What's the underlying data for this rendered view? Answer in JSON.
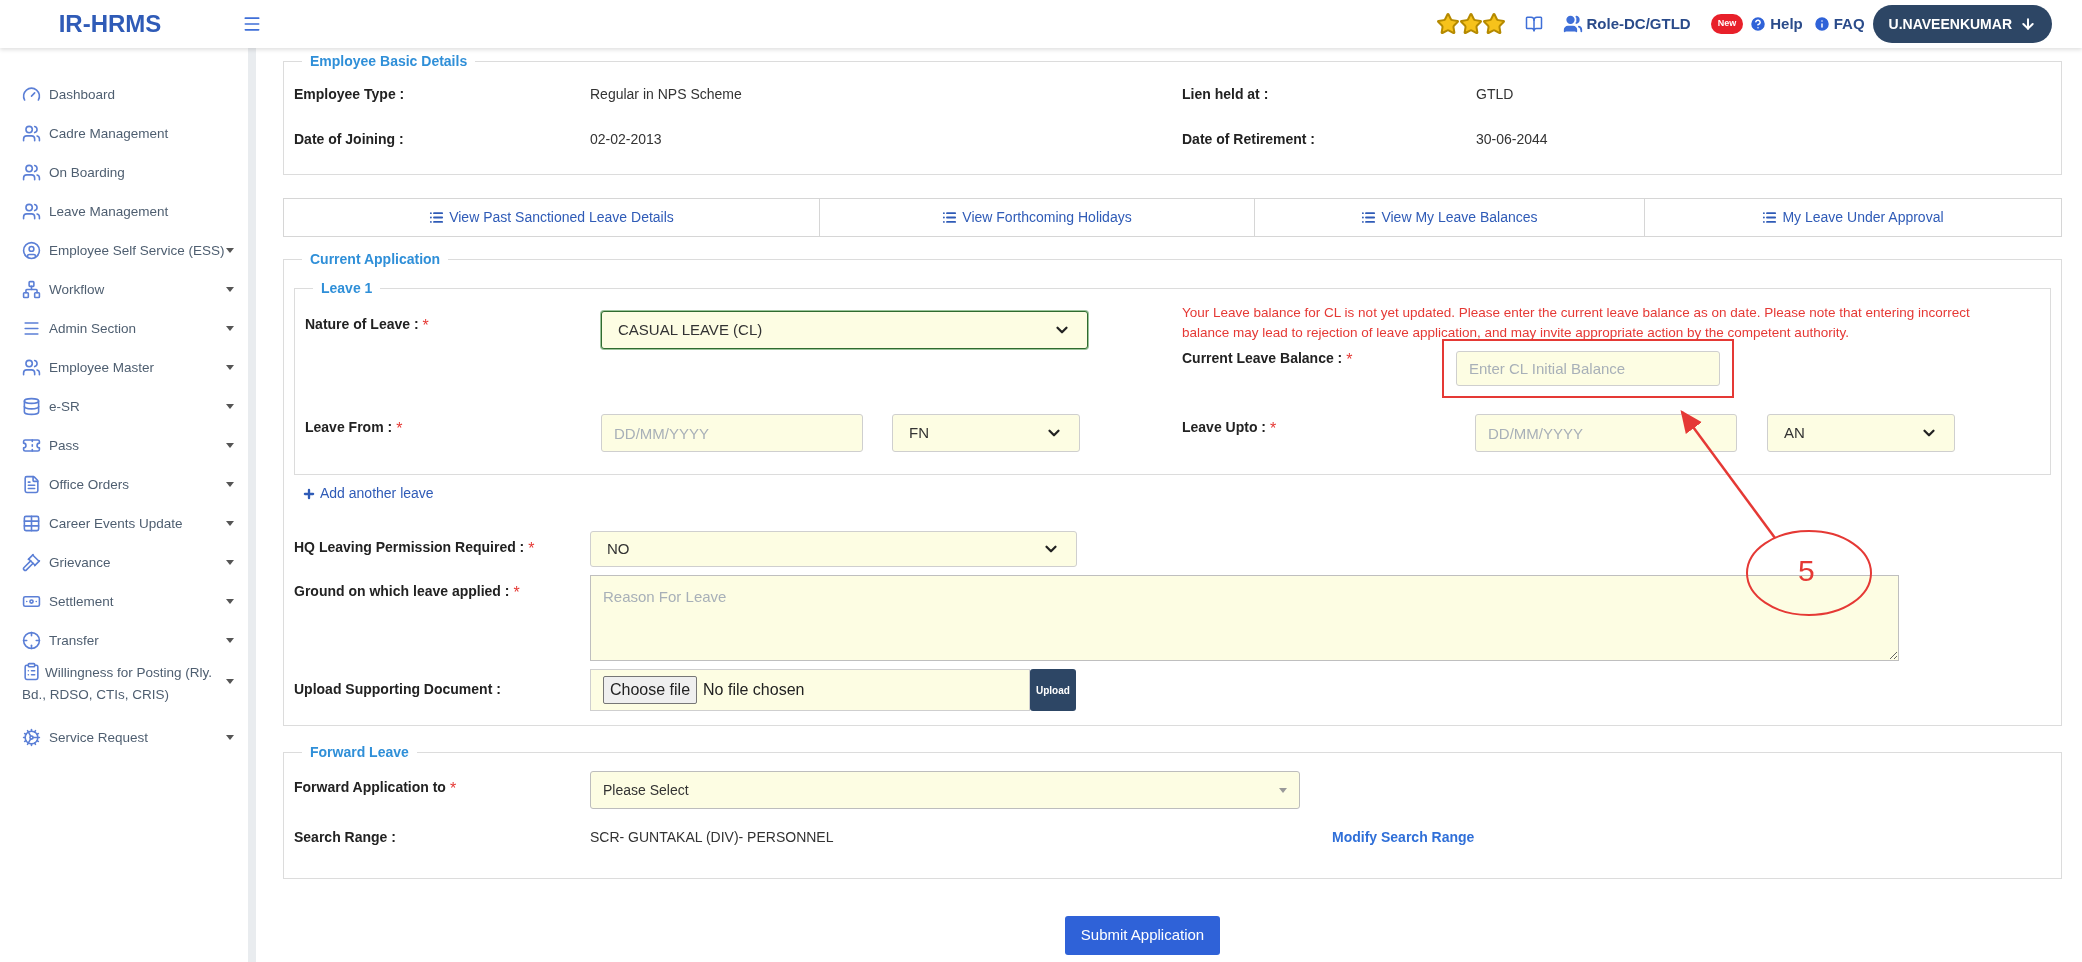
{
  "header": {
    "logo": "IR-HRMS",
    "stars": 3,
    "role": "Role-DC/GTLD",
    "new_badge": "New",
    "help": "Help",
    "faq": "FAQ",
    "user": "U.NAVEENKUMAR"
  },
  "sidebar": {
    "items": [
      {
        "label": "Dashboard",
        "kind": "link"
      },
      {
        "label": "Cadre Management",
        "kind": "link"
      },
      {
        "label": "On Boarding",
        "kind": "link"
      },
      {
        "label": "Leave Management",
        "kind": "link"
      },
      {
        "label": "Employee Self Service (ESS)",
        "kind": "menu"
      },
      {
        "label": "Workflow",
        "kind": "menu"
      },
      {
        "label": "Admin Section",
        "kind": "menu"
      },
      {
        "label": "Employee Master",
        "kind": "menu"
      },
      {
        "label": "e-SR",
        "kind": "menu"
      },
      {
        "label": "Pass",
        "kind": "menu"
      },
      {
        "label": "Office Orders",
        "kind": "menu"
      },
      {
        "label": "Career Events Update",
        "kind": "menu"
      },
      {
        "label": "Grievance",
        "kind": "menu"
      },
      {
        "label": "Settlement",
        "kind": "menu"
      },
      {
        "label": "Transfer",
        "kind": "menu"
      },
      {
        "label": "Willingness for Posting (Rly. Bd., RDSO, CTIs, CRIS)",
        "kind": "menu"
      },
      {
        "label": "Service Request",
        "kind": "menu"
      }
    ]
  },
  "employee_basic_details": {
    "legend": "Employee Basic Details",
    "fields": [
      {
        "label": "Employee Type :",
        "value": "Regular in NPS Scheme"
      },
      {
        "label": "Lien held at :",
        "value": "GTLD"
      },
      {
        "label": "Date of Joining :",
        "value": "02-02-2013"
      },
      {
        "label": "Date of Retirement :",
        "value": "30-06-2044"
      }
    ]
  },
  "view_links": [
    "View Past Sanctioned Leave Details",
    "View Forthcoming Holidays",
    "View My Leave Balances",
    "My Leave Under Approval"
  ],
  "current_application": {
    "legend": "Current Application",
    "leave": {
      "legend": "Leave 1",
      "nature_of_leave": {
        "label": "Nature of Leave :",
        "required_mark": "*",
        "value": "CASUAL LEAVE (CL)"
      },
      "notice": "Your Leave balance for CL is not yet updated. Please enter the current leave balance as on date. Please note that entering incorrect balance may lead to rejection of leave application, and may invite appropriate action by the competent authority.",
      "current_leave_balance": {
        "label": "Current Leave Balance :",
        "required_mark": "*",
        "placeholder": "Enter CL Initial Balance"
      },
      "leave_from": {
        "label": "Leave From :",
        "required_mark": "*",
        "placeholder": "DD/MM/YYYY",
        "session": "FN"
      },
      "leave_upto": {
        "label": "Leave Upto :",
        "required_mark": "*",
        "placeholder": "DD/MM/YYYY",
        "session": "AN"
      }
    },
    "add_leave": "Add another leave",
    "hq_permission": {
      "label": "HQ Leaving Permission Required :",
      "required_mark": "*",
      "value": "NO"
    },
    "ground": {
      "label": "Ground on which leave applied :",
      "required_mark": "*",
      "placeholder": "Reason For Leave"
    },
    "upload": {
      "label": "Upload Supporting Document :",
      "choose": "Choose file",
      "status": "No file chosen",
      "button": "Upload"
    }
  },
  "forward_leave": {
    "legend": "Forward Leave",
    "forward_to": {
      "label": "Forward Application to",
      "required_mark": "*",
      "value": "Please Select"
    },
    "search_range": {
      "label": "Search Range :",
      "value": "SCR- GUNTAKAL (DIV)- PERSONNEL"
    },
    "modify": "Modify Search Range"
  },
  "submit": "Submit Application",
  "annotation": {
    "label": "5"
  }
}
